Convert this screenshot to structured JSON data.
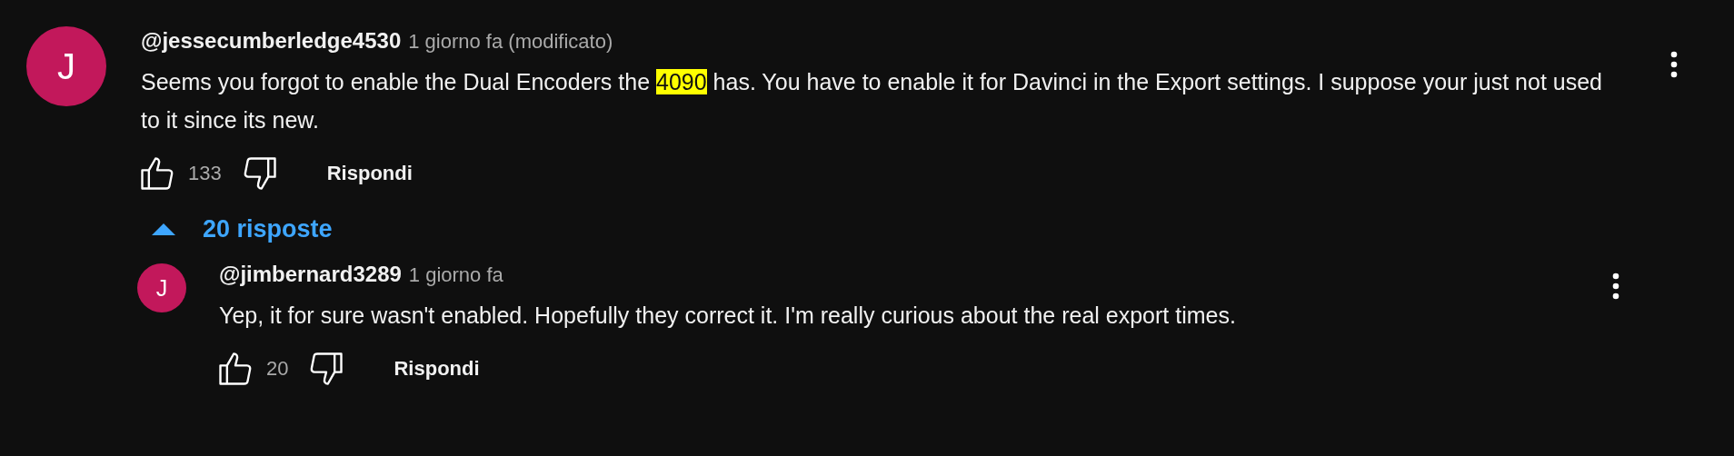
{
  "comment": {
    "avatar": "J",
    "author": "@jessecumberledge4530",
    "time": "1 giorno fa (modificato)",
    "body": [
      {
        "text": "Seems you forgot to enable the Dual Encoders the ",
        "highlighted": false
      },
      {
        "text": "4090",
        "highlighted": true
      },
      {
        "text": " has.  You have to enable it for Davinci in the Export settings.  I suppose your just not used to it since its new.",
        "highlighted": false
      }
    ],
    "likes": "133",
    "reply_label": "Rispondi"
  },
  "replies_toggle": {
    "label": "20 risposte",
    "expanded": true
  },
  "replies": [
    {
      "avatar": "J",
      "author": "@jimbernard3289",
      "time": "1 giorno fa",
      "body": [
        {
          "text": "Yep, it for sure wasn't enabled. Hopefully they correct it. I'm really curious about the real export times.",
          "highlighted": false
        }
      ],
      "likes": "20",
      "reply_label": "Rispondi"
    }
  ]
}
